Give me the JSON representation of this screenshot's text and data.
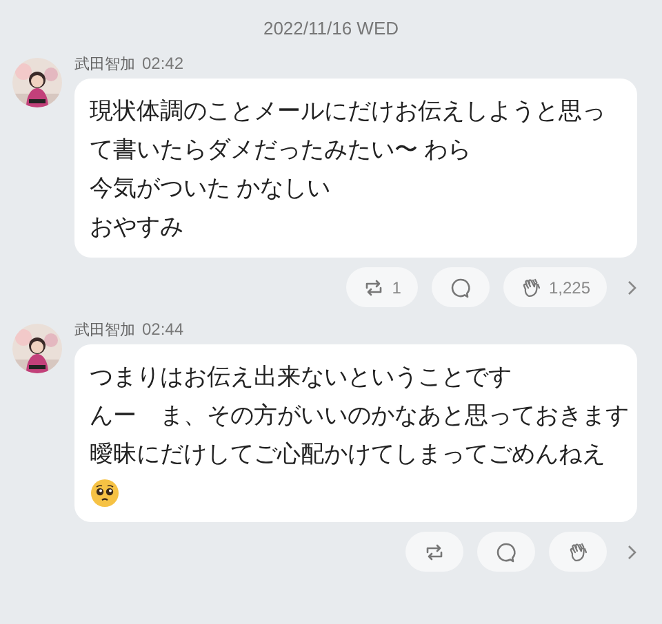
{
  "date": "2022/11/16 WED",
  "messages": [
    {
      "sender": "武田智加",
      "time": "02:42",
      "lines": [
        "現状体調のことメールにだけお伝えしようと思っ",
        "て書いたらダメだったみたい〜 わら",
        "今気がついた かなしい",
        "おやすみ"
      ],
      "emoji": false,
      "actions": [
        {
          "kind": "repost",
          "count": "1"
        },
        {
          "kind": "comment"
        },
        {
          "kind": "clap",
          "count": "1,225"
        }
      ]
    },
    {
      "sender": "武田智加",
      "time": "02:44",
      "lines": [
        "つまりはお伝え出来ないということです",
        "んー　ま、その方がいいのかなあと思っておきます",
        "曖昧にだけしてご心配かけてしまってごめんねえ"
      ],
      "emoji": true,
      "actions": [
        {
          "kind": "repost"
        },
        {
          "kind": "comment"
        },
        {
          "kind": "clap"
        }
      ]
    }
  ]
}
